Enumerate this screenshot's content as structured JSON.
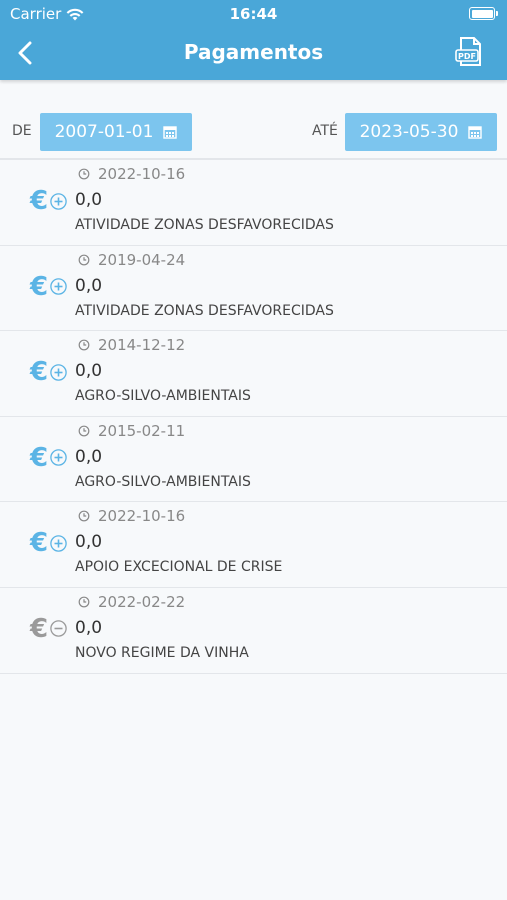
{
  "status_bar": {
    "carrier": "Carrier",
    "time": "16:44"
  },
  "nav": {
    "title": "Pagamentos",
    "pdf_icon_text": "PDF"
  },
  "filter": {
    "from_label": "DE",
    "from_date": "2007-01-01",
    "to_label": "ATÉ",
    "to_date": "2023-05-30"
  },
  "colors": {
    "header": "#4aa7d8",
    "date_button": "#7cc5ee",
    "active_icon": "#5bb4e5",
    "inactive_icon": "#9a9a9a"
  },
  "payments": [
    {
      "date": "2022-10-16",
      "value": "0,0",
      "name": "ATIVIDADE ZONAS DESFAVORECIDAS",
      "status": "plus"
    },
    {
      "date": "2019-04-24",
      "value": "0,0",
      "name": "ATIVIDADE ZONAS DESFAVORECIDAS",
      "status": "plus"
    },
    {
      "date": "2014-12-12",
      "value": "0,0",
      "name": "AGRO-SILVO-AMBIENTAIS",
      "status": "plus"
    },
    {
      "date": "2015-02-11",
      "value": "0,0",
      "name": "AGRO-SILVO-AMBIENTAIS",
      "status": "plus"
    },
    {
      "date": "2022-10-16",
      "value": "0,0",
      "name": "APOIO EXCECIONAL DE CRISE",
      "status": "plus"
    },
    {
      "date": "2022-02-22",
      "value": "0,0",
      "name": "NOVO REGIME DA VINHA",
      "status": "minus"
    }
  ]
}
